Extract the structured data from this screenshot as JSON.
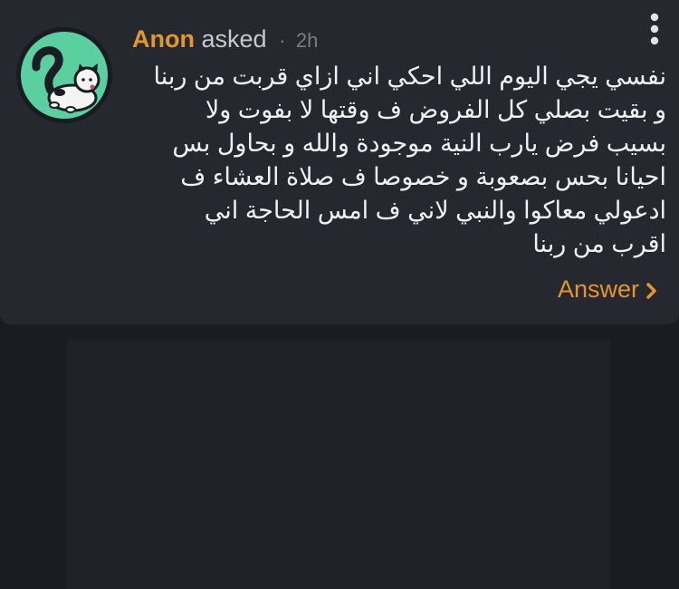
{
  "question_card": {
    "author": "Anon",
    "action": "asked",
    "separator": "·",
    "time": "2h",
    "menu_icon": "more-vertical-icon",
    "avatar_icon": "question-mark-cat-icon",
    "question_lines": [
      "نفسي يجي اليوم اللي احكي اني ازاي قربت من ربنا",
      "و بقيت بصلي كل الفروض ف وقتها لا بفوت ولا",
      "بسيب فرض يارب النية موجودة والله و بحاول بس",
      "احيانا بحس بصعوبة و خصوصا ف صلاة العشاء ف",
      "ادعولي معاكوا والنبي لاني ف امس الحاجة اني",
      "اقرب من ربنا"
    ],
    "answer_label": "Answer",
    "answer_icon": "chevron-right-icon",
    "accent_color": "#e3962e",
    "avatar_color": "#5ad0a0"
  }
}
